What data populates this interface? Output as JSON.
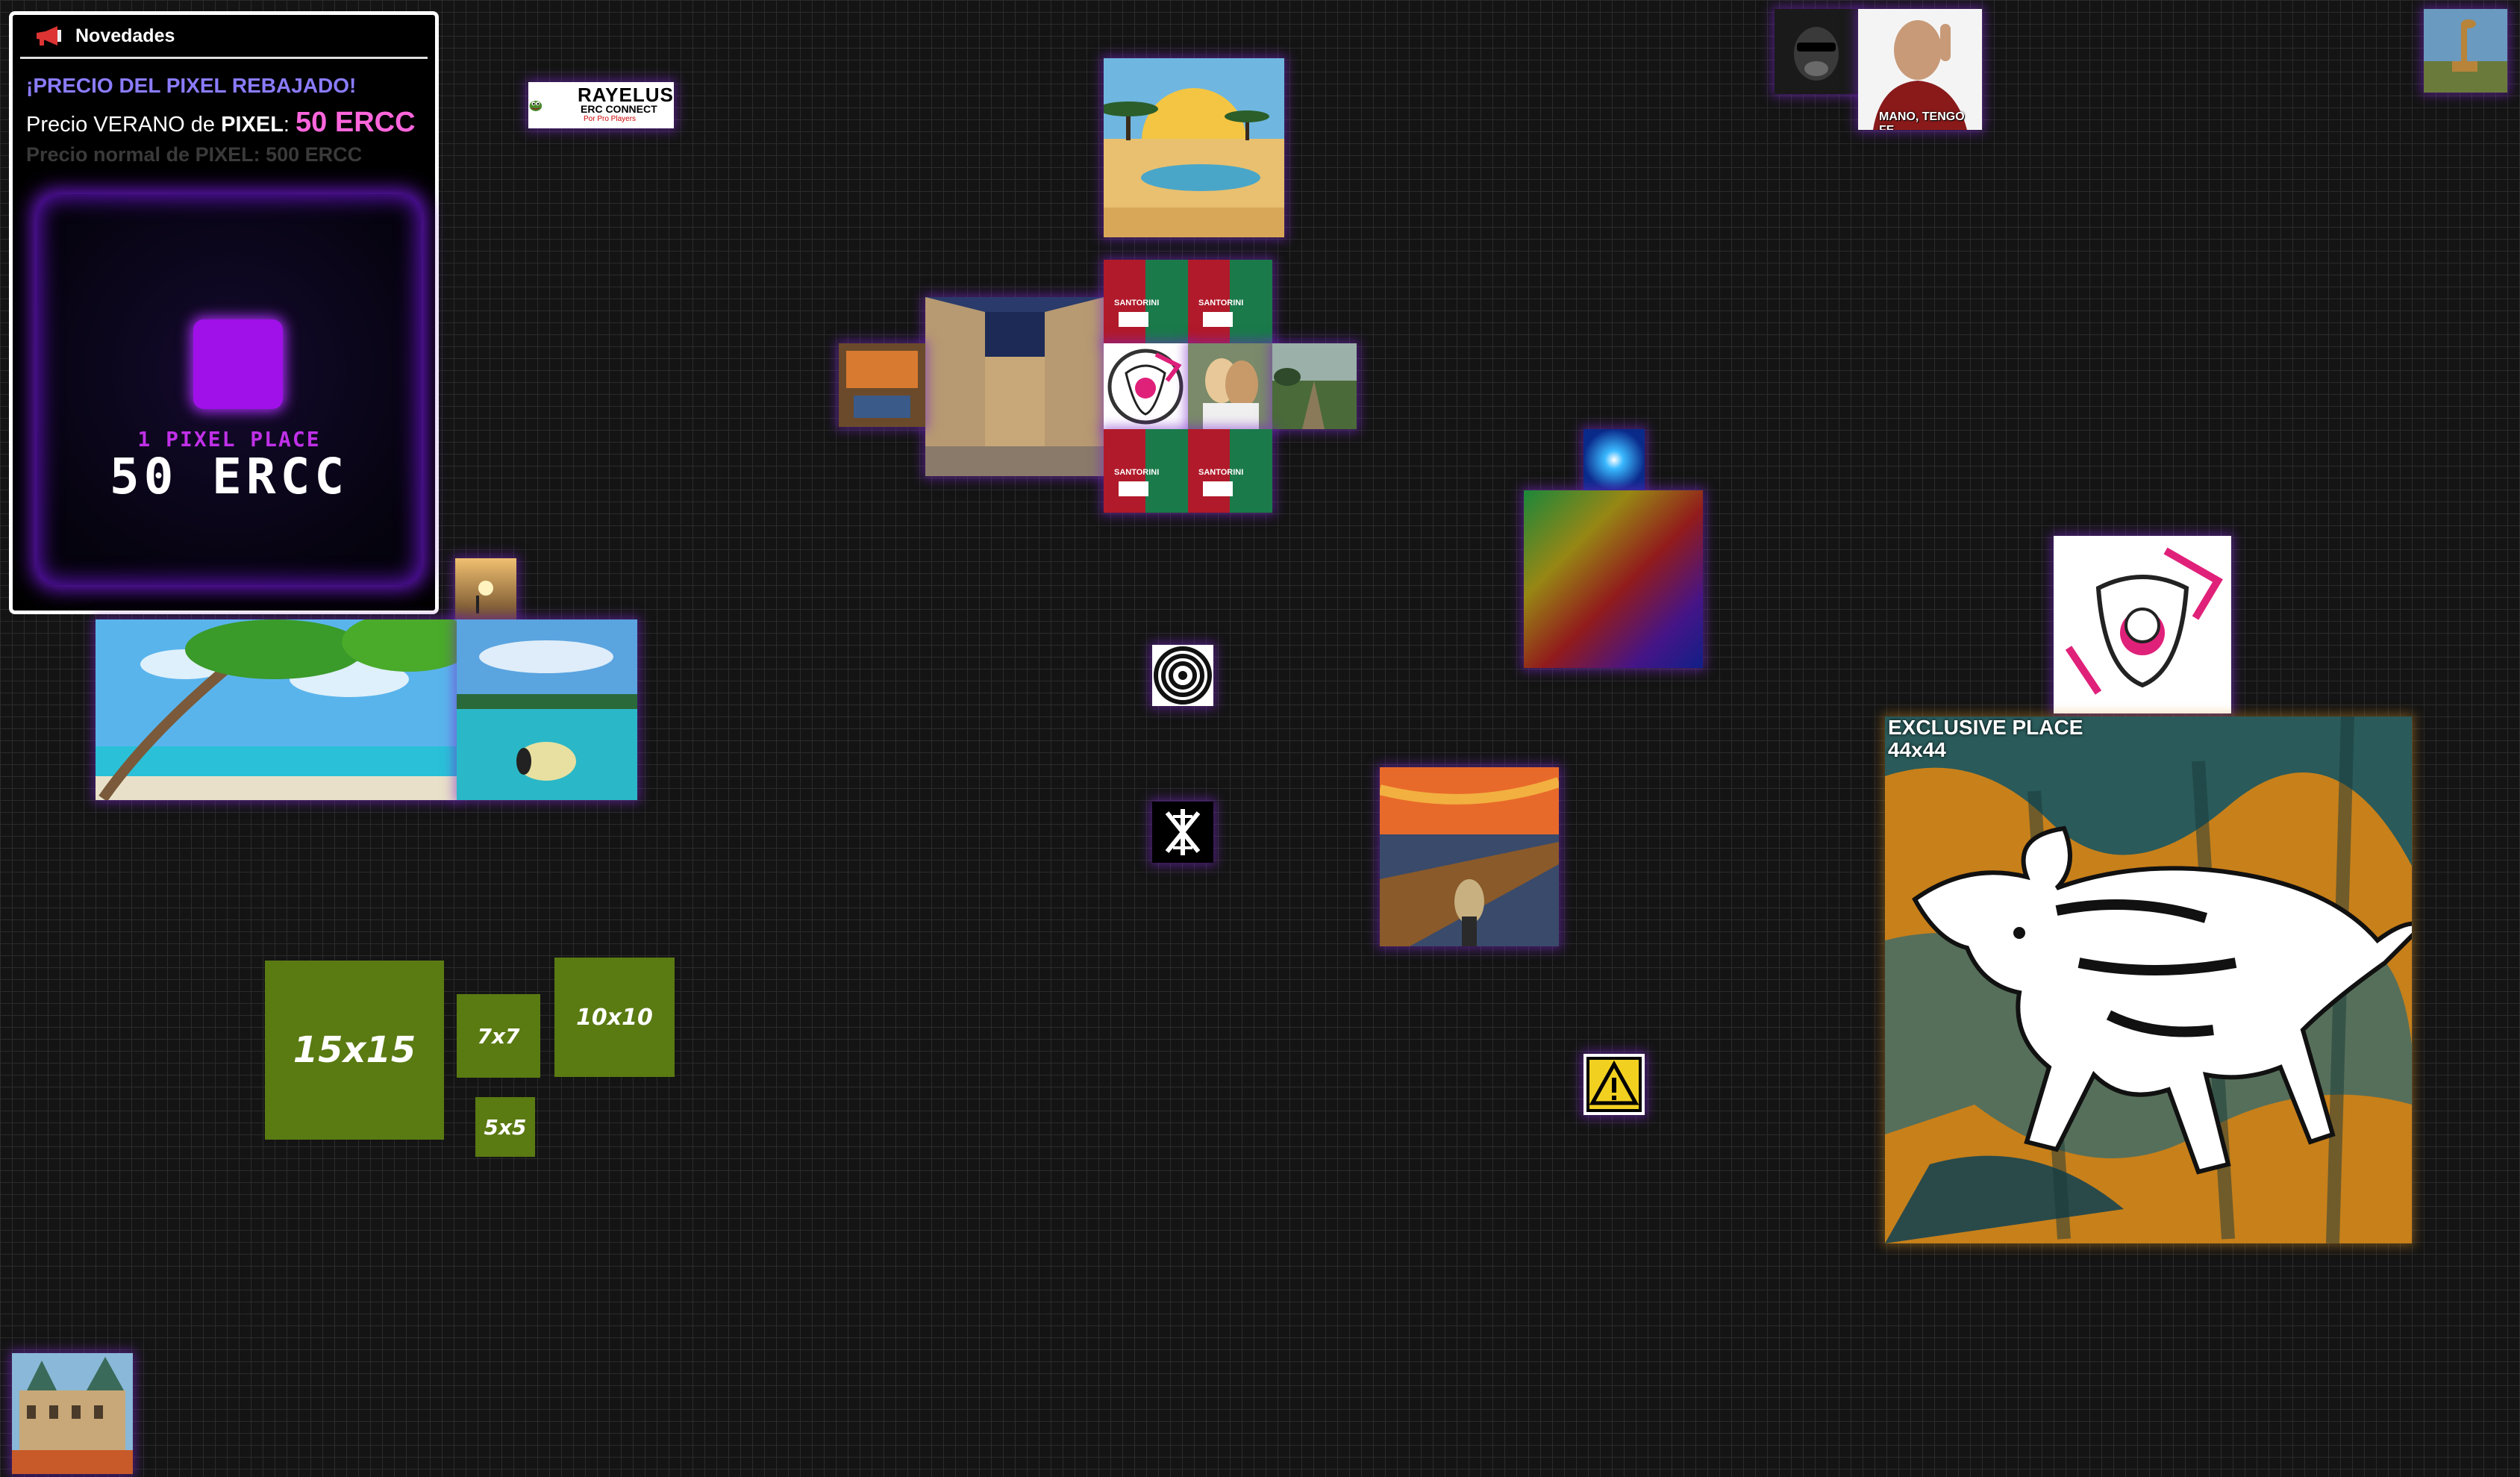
{
  "news": {
    "title": "Novedades",
    "headline": "¡PRECIO DEL PIXEL REBAJADO!",
    "summer_prefix": "Precio VERANO de",
    "summer_pixel_word": "PIXEL",
    "summer_price": "50 ERCC",
    "normal_price_line": "Precio normal de PIXEL: 500 ERCC",
    "promo_caption": "1 PIXEL PLACE",
    "promo_price": "50 ERCC"
  },
  "tiles": {
    "rayelus_title": "RAYELUS",
    "rayelus_sub": "ERC CONNECT",
    "rayelus_sub2": "Por Pro Players",
    "santorini": "SANTORINI",
    "meme_caption": "MANO, TENGO FE"
  },
  "size_examples": {
    "s15": "15x15",
    "s7": "7x7",
    "s10": "10x10",
    "s5": "5x5"
  },
  "exclusive": {
    "label": "EXCLUSIVE PLACE",
    "size": "44x44"
  },
  "colors": {
    "accent_purple": "#a010e8",
    "headline_blue": "#8a7cff",
    "price_pink": "#ff66dd",
    "size_green": "#5a7a12"
  }
}
